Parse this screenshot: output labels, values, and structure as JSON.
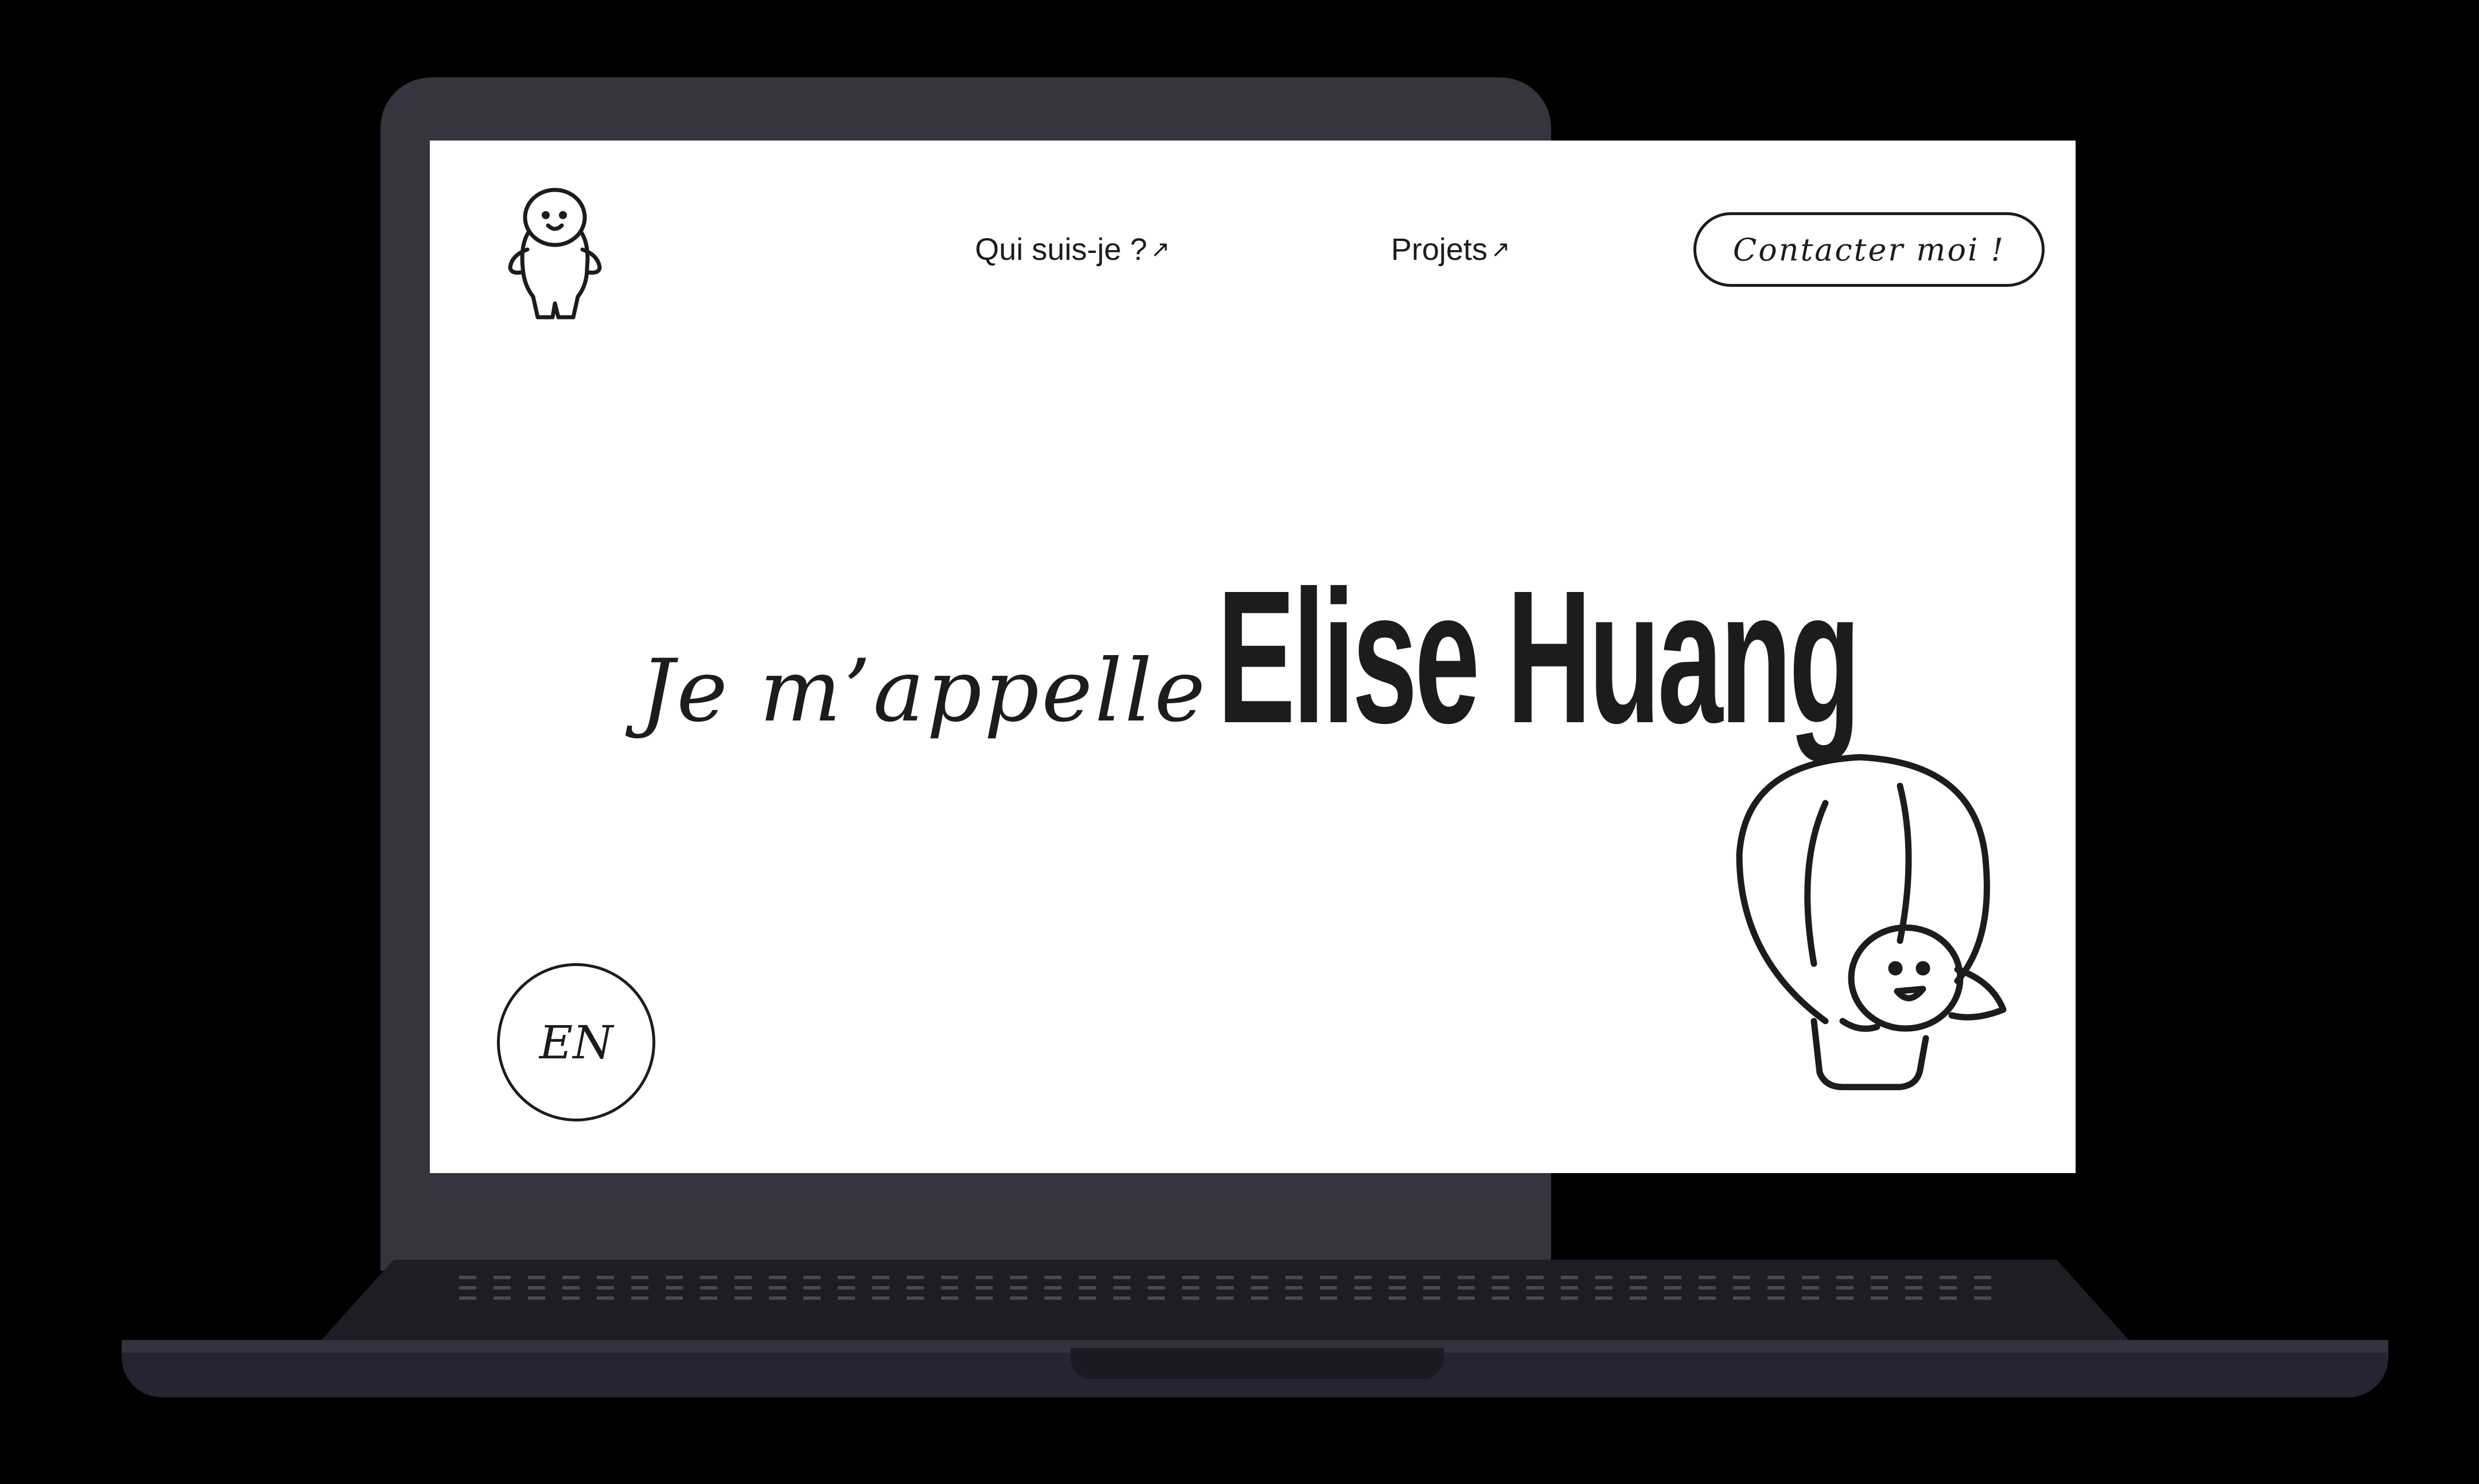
{
  "nav": {
    "link_1_label": "Qui suis-je ?",
    "link_2_label": "Projets",
    "arrow": "↗",
    "contact_label": "Contacter moi !"
  },
  "hero": {
    "intro": "Je m’appelle",
    "name": "Elise Huang"
  },
  "language_button": "EN",
  "icons": {
    "logo": "smiling-character-icon",
    "illustration": "hot-air-balloon-character-icon",
    "nav_arrow": "arrow-up-right-icon"
  },
  "colors": {
    "screen_bg": "#ffffff",
    "ink": "#1c1c1c",
    "laptop_body": "#35343f",
    "backdrop": "#000000"
  }
}
